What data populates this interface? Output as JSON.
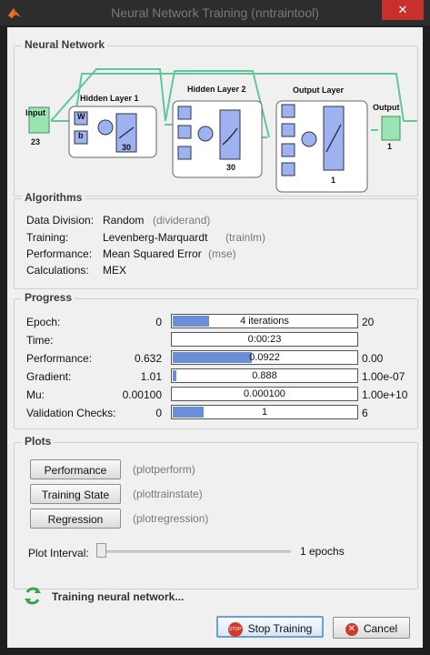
{
  "window": {
    "title": "Neural Network Training (nntraintool)",
    "close_label": "✕"
  },
  "network": {
    "section_title": "Neural Network",
    "input_label": "Input",
    "input_size": "23",
    "hidden1_label": "Hidden Layer 1",
    "hidden1_size": "30",
    "hidden2_label": "Hidden Layer 2",
    "hidden2_size": "30",
    "output_layer_label": "Output Layer",
    "output_layer_size": "1",
    "output_label": "Output",
    "output_size": "1",
    "weight_label": "W",
    "bias_label": "b"
  },
  "algorithms": {
    "section_title": "Algorithms",
    "rows": [
      {
        "label": "Data Division:",
        "value": "Random",
        "func": "(dividerand)"
      },
      {
        "label": "Training:",
        "value": "Levenberg-Marquardt",
        "func": "(trainlm)"
      },
      {
        "label": "Performance:",
        "value": "Mean Squared Error",
        "func": "(mse)"
      },
      {
        "label": "Calculations:",
        "value": "MEX",
        "func": ""
      }
    ]
  },
  "progress": {
    "section_title": "Progress",
    "rows": [
      {
        "label": "Epoch:",
        "start": "0",
        "current": "4 iterations",
        "end": "20",
        "fill": 0.2
      },
      {
        "label": "Time:",
        "start": "",
        "current": "0:00:23",
        "end": "",
        "fill": 0.0
      },
      {
        "label": "Performance:",
        "start": "0.632",
        "current": "0.0922",
        "end": "0.00",
        "fill": 0.43
      },
      {
        "label": "Gradient:",
        "start": "1.01",
        "current": "0.888",
        "end": "1.00e-07",
        "fill": 0.02
      },
      {
        "label": "Mu:",
        "start": "0.00100",
        "current": "0.000100",
        "end": "1.00e+10",
        "fill": 0.0
      },
      {
        "label": "Validation Checks:",
        "start": "0",
        "current": "1",
        "end": "6",
        "fill": 0.17
      }
    ]
  },
  "plots": {
    "section_title": "Plots",
    "buttons": [
      {
        "label": "Performance",
        "func": "(plotperform)"
      },
      {
        "label": "Training State",
        "func": "(plottrainstate)"
      },
      {
        "label": "Regression",
        "func": "(plotregression)"
      }
    ],
    "interval_label": "Plot Interval:",
    "interval_value": "1 epochs",
    "interval_position": 0.0
  },
  "status": {
    "message": "Training neural network..."
  },
  "buttons": {
    "stop": "Stop Training",
    "cancel": "Cancel",
    "stop_icon_text": "STOP"
  },
  "colors": {
    "accent": "#6a8ed8",
    "layer_block": "#9fb2f0",
    "io_block": "#9be3b3",
    "wire": "#5fc79a"
  }
}
